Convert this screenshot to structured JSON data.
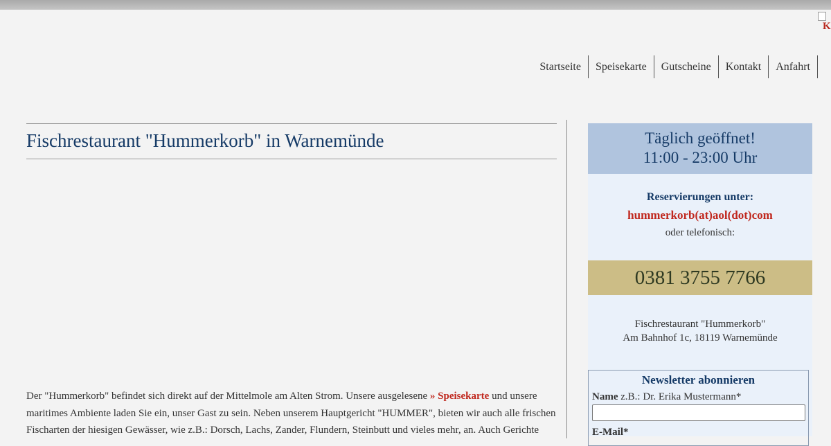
{
  "header": {
    "broken_image_alt": "K"
  },
  "nav": {
    "items": [
      {
        "label": "Startseite"
      },
      {
        "label": "Speisekarte"
      },
      {
        "label": "Gutscheine"
      },
      {
        "label": "Kontakt"
      },
      {
        "label": "Anfahrt"
      }
    ]
  },
  "main": {
    "title": "Fischrestaurant \"Hummerkorb\" in Warnemünde",
    "intro_part1": "Der \"Hummerkorb\" befindet sich direkt auf der Mittelmole am Alten Strom. Unsere ausgelesene ",
    "intro_link": "» Speisekarte",
    "intro_part2": " und unsere maritimes Ambiente laden Sie ein, unser Gast zu sein. Neben unserem Hauptgericht \"HUMMER\", bieten wir auch alle frischen Fischarten der hiesigen Gewässer, wie z.B.: Dorsch, Lachs, Zander, Flundern, Steinbutt und vieles mehr, an. Auch Gerichte"
  },
  "sidebar": {
    "hours_line1": "Täglich geöffnet!",
    "hours_line2": "11:00 - 23:00 Uhr",
    "reservation_label": "Reservierungen unter:",
    "reservation_email": "hummerkorb(at)aol(dot)com",
    "reservation_phone_label": "oder telefonisch:",
    "phone": "0381 3755 7766",
    "address_line1": "Fischrestaurant \"Hummerkorb\"",
    "address_line2": "Am Bahnhof 1c, 18119 Warnemünde",
    "newsletter": {
      "title": "Newsletter abonnieren",
      "name_label": "Name",
      "name_hint": " z.B.: Dr. Erika Mustermann*",
      "name_value": "",
      "email_label": "E-Mail*"
    }
  },
  "colors": {
    "title": "#153a66",
    "link": "#c0281e",
    "hours_bg": "#b0c4de",
    "phone_bg": "#ccbd86",
    "sidebar_bg": "#eaf1fa"
  }
}
